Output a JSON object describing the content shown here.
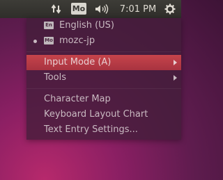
{
  "topbar": {
    "ime_indicator": "Mo",
    "clock": "7:01 PM",
    "icons": [
      "network-arrows-icon",
      "volume-icon",
      "gear-icon"
    ]
  },
  "menu": {
    "items": [
      {
        "label": "English (US)",
        "tag": "En"
      },
      {
        "label": "mozc-jp",
        "tag": "Mo",
        "selected": true
      },
      {
        "label": "Input Mode (A)",
        "submenu": true,
        "highlighted": true
      },
      {
        "label": "Tools",
        "submenu": true
      },
      {
        "label": "Character Map"
      },
      {
        "label": "Keyboard Layout Chart"
      },
      {
        "label": "Text Entry Settings..."
      }
    ]
  },
  "colors": {
    "panel": "#35342f",
    "menu_bg": "#431e3a",
    "highlight": "#c6444b",
    "text": "#c9b9c1"
  }
}
